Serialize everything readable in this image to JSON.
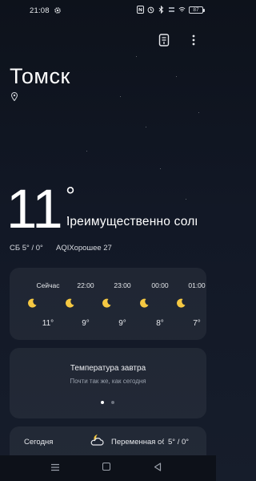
{
  "status_bar": {
    "time": "21:08",
    "battery": "87",
    "icons": [
      "gear-icon",
      "nfc-icon",
      "alarm-icon",
      "bluetooth-icon",
      "network-speed-icon",
      "wifi-icon",
      "battery-icon"
    ]
  },
  "top_actions": [
    "manage-locations-icon",
    "more-options-icon"
  ],
  "location": {
    "city": "Томск",
    "icon": "location-pin-icon"
  },
  "current": {
    "temperature": "11",
    "degree_symbol": "°",
    "condition": "Преимущественно солнечно",
    "day_summary": "СБ 5° / 0°",
    "aqi": "AQIХорошее 27"
  },
  "hourly": [
    {
      "time": "Сейчас",
      "icon": "moon-icon",
      "temp": "11°"
    },
    {
      "time": "22:00",
      "icon": "moon-icon",
      "temp": "9°"
    },
    {
      "time": "23:00",
      "icon": "moon-icon",
      "temp": "9°"
    },
    {
      "time": "00:00",
      "icon": "moon-icon",
      "temp": "8°"
    },
    {
      "time": "01:00",
      "icon": "moon-icon",
      "temp": "7°"
    }
  ],
  "tomorrow_card": {
    "title": "Температура завтра",
    "subtitle": "Почти так же, как сегодня",
    "page_count": 2,
    "active_page": 1
  },
  "daily": [
    {
      "day": "Сегодня",
      "icon": "partly-cloudy-night-icon",
      "condition": "Переменная облачность",
      "temp": "5° / 0°"
    }
  ],
  "colors": {
    "background": "#121826",
    "card": "#1e2533",
    "moon": "#f5c842",
    "text_secondary": "#9aa1ad"
  },
  "nav_bar": [
    "menu-icon",
    "home-icon",
    "back-icon"
  ]
}
